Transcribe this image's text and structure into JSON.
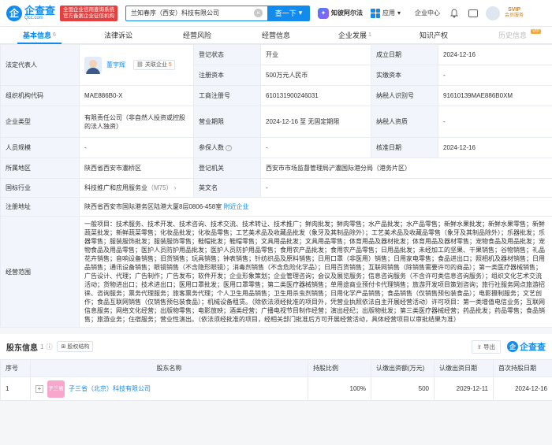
{
  "header": {
    "logo_name": "企查查",
    "logo_domain": "Qcc.com",
    "tag_line1": "全国企业信用查询系统",
    "tag_line2": "官方备案企业征信机构",
    "search_value": "兰知春序（西安）科技有限公司",
    "search_button": "查一下",
    "ai_label": "知彼阿尔法",
    "app_label": "应用",
    "enterprise_center": "企业中心",
    "vip_top": "SVIP",
    "vip_bottom": "会员服务"
  },
  "tabs": [
    {
      "label": "基本信息",
      "count": "6"
    },
    {
      "label": "法律诉讼",
      "count": ""
    },
    {
      "label": "经营风险",
      "count": ""
    },
    {
      "label": "经营信息",
      "count": ""
    },
    {
      "label": "企业发展",
      "count": "1"
    },
    {
      "label": "知识产权",
      "count": ""
    },
    {
      "label": "历史信息",
      "count": ""
    }
  ],
  "info": {
    "legal_rep_label": "法定代表人",
    "legal_rep_name": "董宇辉",
    "assoc_label": "关联企业",
    "assoc_count": "5",
    "reg_status_label": "登记状态",
    "reg_status": "开业",
    "est_date_label": "成立日期",
    "est_date": "2024-12-16",
    "reg_capital_label": "注册资本",
    "reg_capital": "500万元人民币",
    "paid_capital_label": "实缴资本",
    "paid_capital": "-",
    "org_code_label": "组织机构代码",
    "org_code": "MAE886B0-X",
    "biz_reg_label": "工商注册号",
    "biz_reg": "610131900246031",
    "taxpayer_id_label": "纳税人识别号",
    "taxpayer_id": "91610139MAE886B0XM",
    "type_label": "企业类型",
    "type": "有限责任公司（非自然人投资或控股的法人独资）",
    "term_label": "营业期限",
    "term": "2024-12-16 至 无固定期限",
    "taxpayer_q_label": "纳税人资质",
    "taxpayer_q": "-",
    "staff_label": "人员规模",
    "staff": "-",
    "insured_label": "参保人数",
    "insured": "-",
    "approve_label": "核准日期",
    "approve": "2024-12-16",
    "region_label": "所属地区",
    "region": "陕西省西安市灞桥区",
    "authority_label": "登记机关",
    "authority": "西安市市场监督管理局浐灞国际港分局（港务片区）",
    "industry_label": "国标行业",
    "industry": "科技推广和应用服务业",
    "industry_code": "（M75）",
    "en_name_label": "英文名",
    "en_name": "-",
    "address_label": "注册地址",
    "address": "陕西省西安市国际港务区陆港大厦8层0806-458室",
    "nearby": "附近企业",
    "scope_label": "经营范围",
    "scope": "一般项目：技术服务、技术开发、技术咨询、技术交流、技术转让、技术推广；鲜肉批发；鲜肉零售；水产品批发；水产品零售；新鲜水果批发；新鲜水果零售；新鲜蔬菜批发；新鲜蔬菜零售；化妆品批发；化妆品零售；工艺美术品及收藏品批发（象牙及其制品除外）；工艺美术品及收藏品零售（象牙及其制品除外）；乐器批发；乐器零售；服装服饰批发；服装服饰零售；鞋帽批发；鞋帽零售；文具用品批发；文具用品零售；体育用品及器材批发；体育用品及器材零售；宠物食品及用品批发；宠物食品及用品零售；医护人员防护用品批发；医护人员防护用品零售；食用农产品批发；食用农产品零售；日用品批发；未经加工的坚果、干果销售；谷物销售；礼品花卉销售；音响设备销售；旧货销售；玩具销售；钟表销售；针纺织品及原料销售；日用口罩（非医用）销售；日用家电零售；食品进出口；照相机及器材销售；日用品销售；通讯设备销售；眼镜销售（不含隐形眼镜）；消毒剂销售（不含危险化学品）；日用百货销售；互联网销售（除销售需要许可的商品）；第一类医疗器械销售；广告设计、代理；广告制作；广告发布；软件开发；企业形象策划；企业管理咨询；会议及展览服务；信息咨询服务（不含许可类信息咨询服务）；组织文化艺术交流活动；货物进出口；技术进出口；医用口罩批发；医用口罩零售；第二类医疗器械销售；单用途商业预付卡代理销售；旅游开发项目策划咨询；旅行社服务网点旅游招徕、咨询服务；票务代理服务；旅客票务代理；个人卫生用品销售；卫生用杀虫剂销售；日用化学产品销售；食品销售（仅销售预包装食品）；电影摄制服务；文艺创作；食品互联网销售（仅销售预包装食品）；机械设备租赁。（除依法须经批准的项目外，凭营业执照依法自主开展经营活动）许可项目：第一类增值电信业务；互联网信息服务；网络文化经营；出版物零售；电影放映；酒类经营；广播电视节目制作经营；演出经纪；出版物批发；第三类医疗器械经营；药品批发；药品零售；食品销售；旅游业务；住宿服务；营业性演出。（依法须经批准的项目，经相关部门批准后方可开展经营活动，具体经营项目以审批结果为准）"
  },
  "shareholders": {
    "title": "股东信息",
    "count": "1",
    "chip": "股权结构",
    "export": "导出",
    "brand": "企查查",
    "headers": [
      "序号",
      "股东名称",
      "持股比例",
      "认缴出资额(万元)",
      "认缴出资日期",
      "首次持股日期"
    ],
    "rows": [
      {
        "idx": "1",
        "logo_text": "子三省",
        "name": "子三省（北京）科技有限公司",
        "ratio": "100%",
        "amount": "500",
        "date": "2029-12-11",
        "first": "2024-12-16"
      }
    ]
  }
}
